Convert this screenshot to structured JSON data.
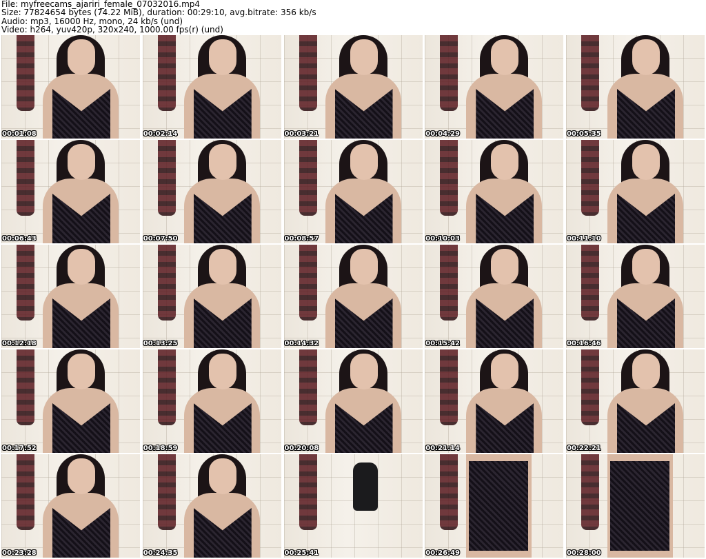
{
  "header": {
    "file": "File: myfreecams_ajariri_female_07032016.mp4",
    "size": "Size: 77824654 bytes (74.22 MiB), duration: 00:29:10, avg.bitrate: 356 kb/s",
    "audio": "Audio: mp3, 16000 Hz, mono, 24 kb/s (und)",
    "video": "Video: h264, yuv420p, 320x240, 1000.00 fps(r) (und)"
  },
  "thumbnails": [
    {
      "time": "00:01:08",
      "scene": "portrait"
    },
    {
      "time": "00:02:14",
      "scene": "portrait"
    },
    {
      "time": "00:03:21",
      "scene": "portrait"
    },
    {
      "time": "00:04:29",
      "scene": "portrait"
    },
    {
      "time": "00:05:35",
      "scene": "portrait"
    },
    {
      "time": "00:06:43",
      "scene": "portrait"
    },
    {
      "time": "00:07:50",
      "scene": "portrait"
    },
    {
      "time": "00:08:57",
      "scene": "portrait"
    },
    {
      "time": "00:10:03",
      "scene": "portrait"
    },
    {
      "time": "00:11:10",
      "scene": "portrait"
    },
    {
      "time": "00:12:18",
      "scene": "portrait"
    },
    {
      "time": "00:13:25",
      "scene": "portrait"
    },
    {
      "time": "00:14:32",
      "scene": "portrait"
    },
    {
      "time": "00:15:42",
      "scene": "portrait"
    },
    {
      "time": "00:16:46",
      "scene": "portrait"
    },
    {
      "time": "00:17:52",
      "scene": "portrait"
    },
    {
      "time": "00:18:59",
      "scene": "portrait"
    },
    {
      "time": "00:20:08",
      "scene": "portrait"
    },
    {
      "time": "00:21:14",
      "scene": "portrait"
    },
    {
      "time": "00:22:21",
      "scene": "portrait"
    },
    {
      "time": "00:23:28",
      "scene": "portrait"
    },
    {
      "time": "00:24:35",
      "scene": "portrait"
    },
    {
      "time": "00:25:41",
      "scene": "room"
    },
    {
      "time": "00:26:49",
      "scene": "full"
    },
    {
      "time": "00:28:00",
      "scene": "full"
    }
  ]
}
